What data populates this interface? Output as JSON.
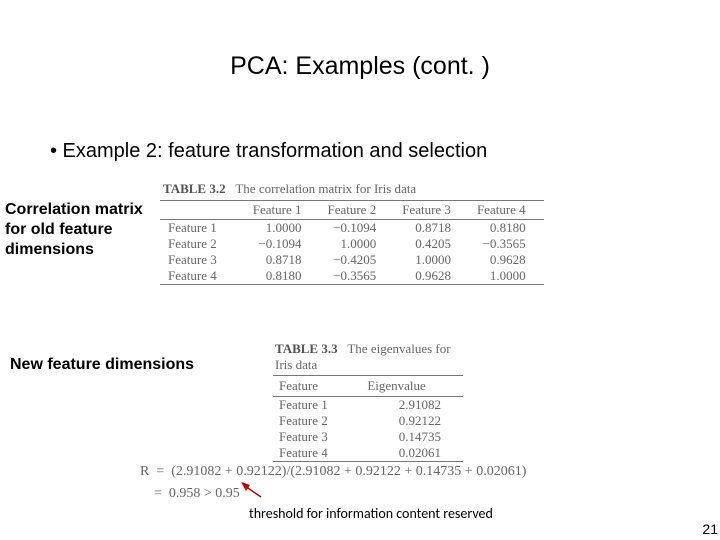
{
  "title": "PCA: Examples (cont. )",
  "bullet": "•   Example 2: feature transformation and selection",
  "label_corr_1": "Correlation matrix",
  "label_corr_2": "for old feature",
  "label_corr_3": "dimensions",
  "label_new": "New feature dimensions",
  "table32": {
    "caption_bold": "TABLE 3.2",
    "caption_rest": "The correlation matrix for Iris data",
    "headers": [
      "",
      "Feature 1",
      "Feature 2",
      "Feature 3",
      "Feature 4"
    ],
    "rows": [
      {
        "h": "Feature 1",
        "v": [
          "1.0000",
          "−0.1094",
          "0.8718",
          "0.8180"
        ]
      },
      {
        "h": "Feature 2",
        "v": [
          "−0.1094",
          "1.0000",
          "0.4205",
          "−0.3565"
        ]
      },
      {
        "h": "Feature 3",
        "v": [
          "0.8718",
          "−0.4205",
          "1.0000",
          "0.9628"
        ]
      },
      {
        "h": "Feature 4",
        "v": [
          "0.8180",
          "−0.3565",
          "0.9628",
          "1.0000"
        ]
      }
    ]
  },
  "table33": {
    "caption_bold": "TABLE 3.3",
    "caption_rest": "The eigenvalues for Iris data",
    "headers": [
      "Feature",
      "Eigenvalue"
    ],
    "rows": [
      {
        "h": "Feature 1",
        "v": "2.91082"
      },
      {
        "h": "Feature 2",
        "v": "0.92122"
      },
      {
        "h": "Feature 3",
        "v": "0.14735"
      },
      {
        "h": "Feature 4",
        "v": "0.02061"
      }
    ]
  },
  "equation_line1": "R  =  (2.91082 + 0.92122)/(2.91082 + 0.92122 + 0.14735 + 0.02061)",
  "equation_line2": "    =  0.958 > 0.95",
  "bottom_caption": "threshold for information content reserved",
  "pagenum": "21",
  "chart_data": {
    "type": "table",
    "tables": [
      {
        "name": "Correlation matrix for Iris data",
        "columns": [
          "Feature 1",
          "Feature 2",
          "Feature 3",
          "Feature 4"
        ],
        "rows": [
          "Feature 1",
          "Feature 2",
          "Feature 3",
          "Feature 4"
        ],
        "values": [
          [
            1.0,
            -0.1094,
            0.8718,
            0.818
          ],
          [
            -0.1094,
            1.0,
            0.4205,
            -0.3565
          ],
          [
            0.8718,
            -0.4205,
            1.0,
            0.9628
          ],
          [
            0.818,
            -0.3565,
            0.9628,
            1.0
          ]
        ]
      },
      {
        "name": "Eigenvalues for Iris data",
        "columns": [
          "Feature",
          "Eigenvalue"
        ],
        "data": [
          [
            "Feature 1",
            2.91082
          ],
          [
            "Feature 2",
            0.92122
          ],
          [
            "Feature 3",
            0.14735
          ],
          [
            "Feature 4",
            0.02061
          ]
        ]
      }
    ],
    "equation": "R = (2.91082 + 0.92122)/(2.91082 + 0.92122 + 0.14735 + 0.02061) = 0.958 > 0.95"
  }
}
